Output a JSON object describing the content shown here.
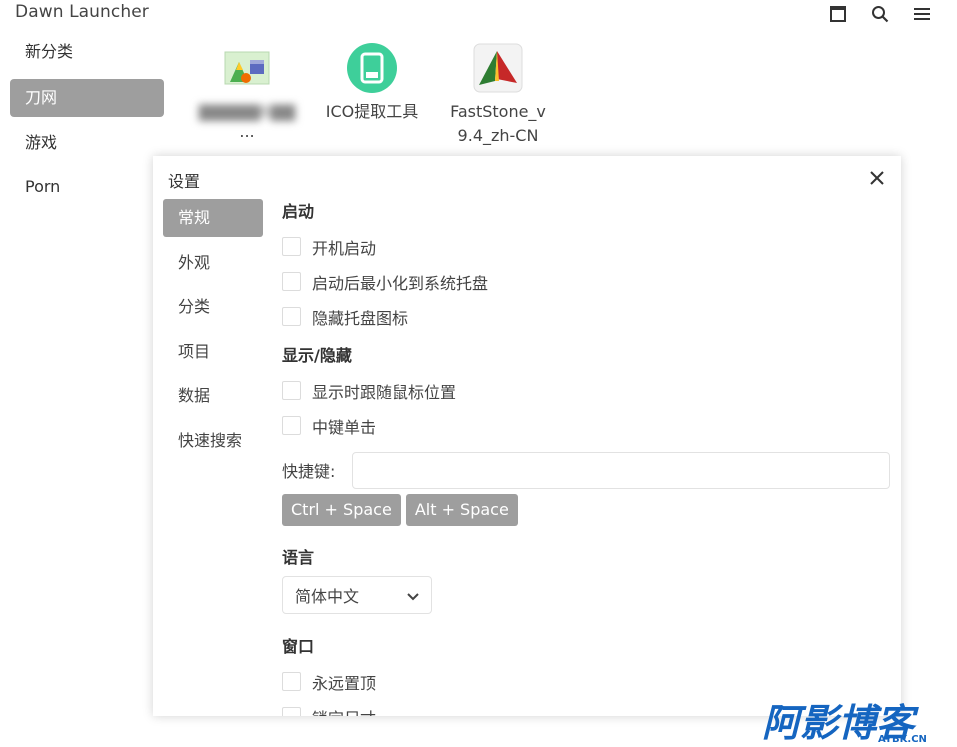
{
  "app": {
    "title": "Dawn Launcher"
  },
  "sidebar": {
    "items": [
      {
        "label": "新分类"
      },
      {
        "label": "刀网"
      },
      {
        "label": "游戏"
      },
      {
        "label": "Porn"
      }
    ]
  },
  "items": [
    {
      "label_line1": "▇▇▇▇▇6▇▇",
      "label_line2": "...",
      "icon": "image-file-icon"
    },
    {
      "label_line1": "ICO提取工具",
      "label_line2": "",
      "icon": "ico-tool-icon"
    },
    {
      "label_line1": "FastStone_v",
      "label_line2": "9.4_zh-CN",
      "icon": "faststone-icon"
    }
  ],
  "settings": {
    "title": "设置",
    "nav": [
      {
        "label": "常规"
      },
      {
        "label": "外观"
      },
      {
        "label": "分类"
      },
      {
        "label": "项目"
      },
      {
        "label": "数据"
      },
      {
        "label": "快速搜索"
      }
    ],
    "startup": {
      "heading": "启动",
      "options": [
        "开机启动",
        "启动后最小化到系统托盘",
        "隐藏托盘图标"
      ]
    },
    "display": {
      "heading": "显示/隐藏",
      "options": [
        "显示时跟随鼠标位置",
        "中键单击"
      ],
      "hotkey_label": "快捷键:",
      "hotkey_value": "",
      "presets": [
        "Ctrl + Space",
        "Alt + Space"
      ]
    },
    "language": {
      "heading": "语言",
      "selected": "简体中文"
    },
    "window": {
      "heading": "窗口",
      "options": [
        "永远置顶",
        "锁定尺寸"
      ]
    }
  },
  "watermark": {
    "text": "阿影博客",
    "sub": "AYBK.CN"
  },
  "colors": {
    "active": "#9e9e9e",
    "watermark": "#1565c0"
  }
}
